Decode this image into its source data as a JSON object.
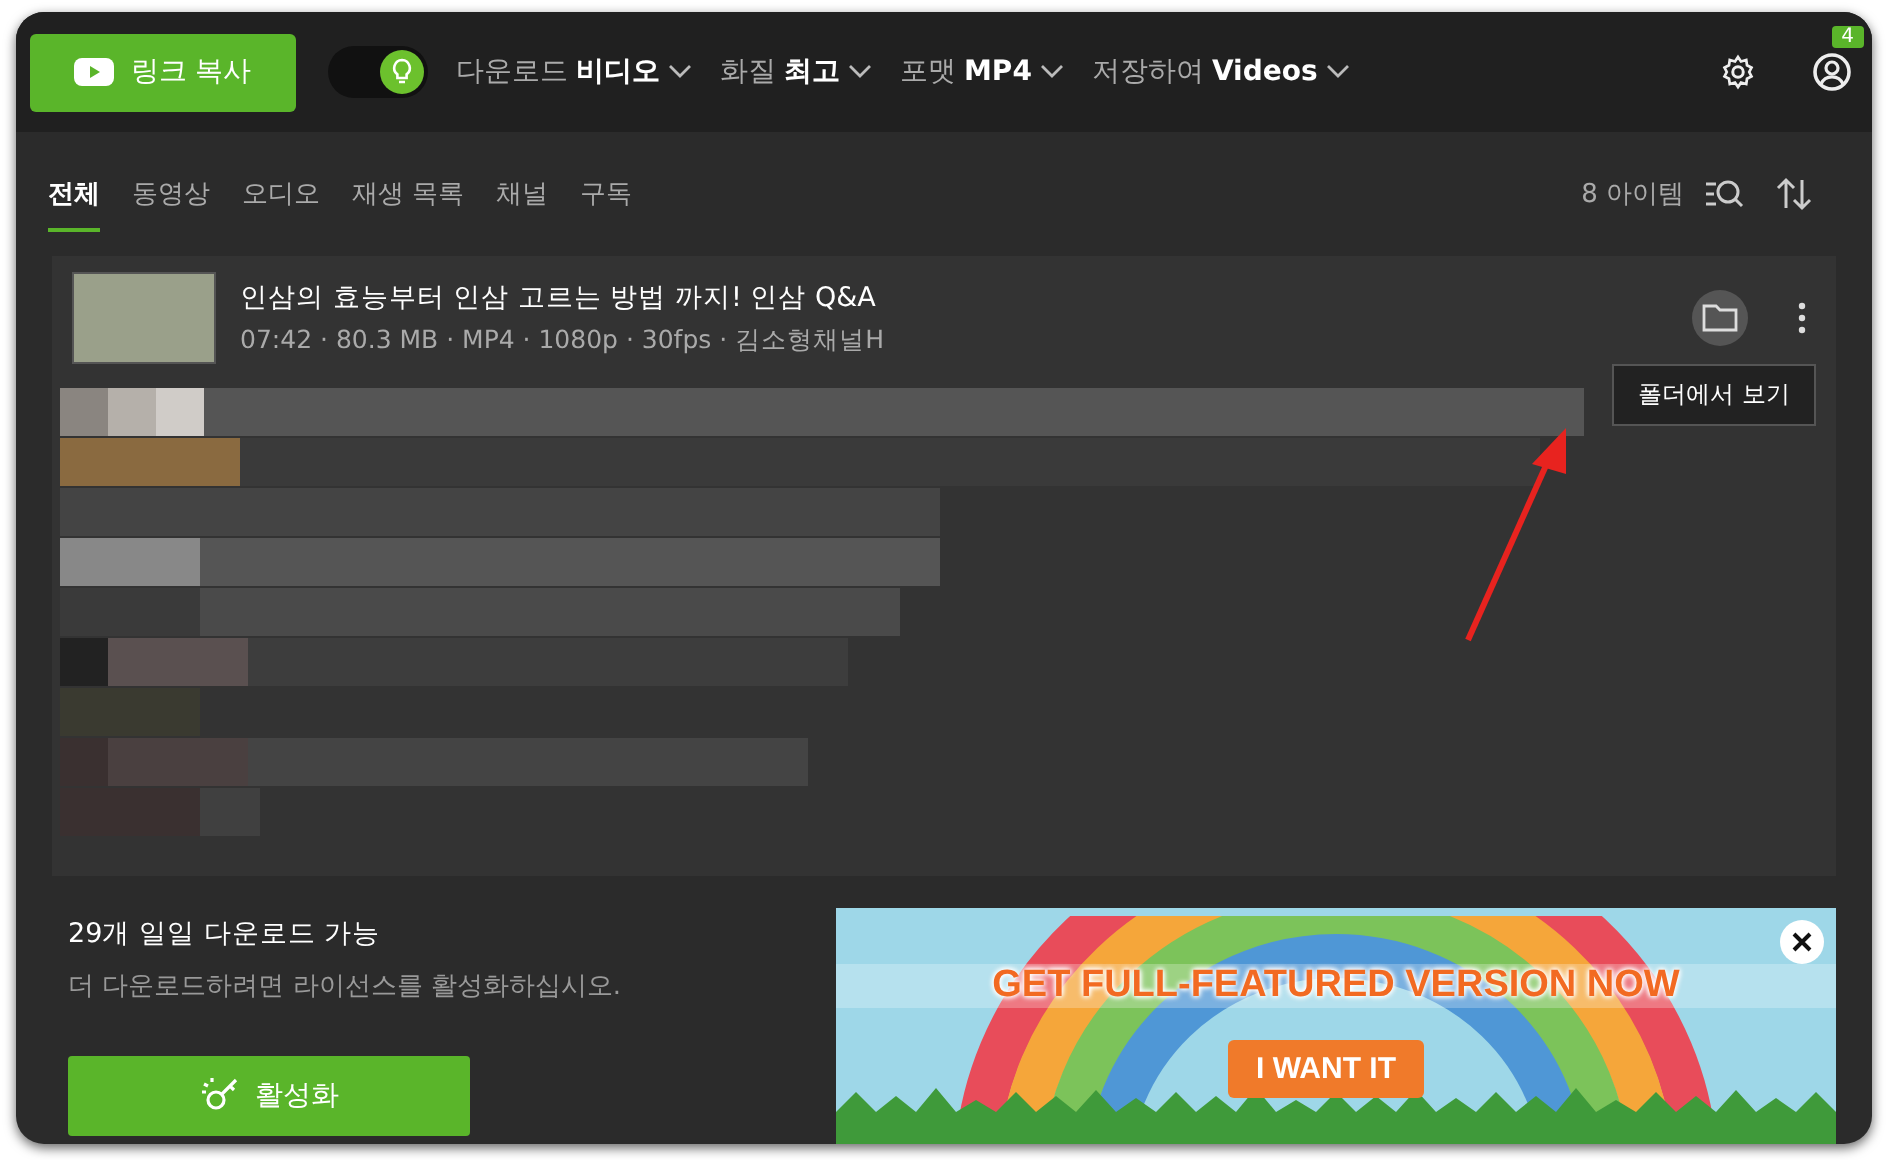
{
  "toolbar": {
    "copy_button": "링크 복사",
    "smart_mode": {
      "on": true
    },
    "dropdowns": [
      {
        "label": "다운로드",
        "value": "비디오"
      },
      {
        "label": "화질",
        "value": "최고"
      },
      {
        "label": "포맷",
        "value": "MP4"
      },
      {
        "label": "저장하여",
        "value": "Videos"
      }
    ],
    "badge": "4"
  },
  "tabs": [
    {
      "label": "전체",
      "selected": true
    },
    {
      "label": "동영상",
      "selected": false
    },
    {
      "label": "오디오",
      "selected": false
    },
    {
      "label": "재생 목록",
      "selected": false
    },
    {
      "label": "채널",
      "selected": false
    },
    {
      "label": "구독",
      "selected": false
    }
  ],
  "item_count": "8 아이템",
  "items": [
    {
      "title": "인삼의 효능부터 인삼 고르는 방법 까지! 인삼 Q&A",
      "meta": "07:42 · 80.3 MB · MP4 · 1080p · 30fps · 김소형채널H"
    }
  ],
  "tooltip": "폴더에서 보기",
  "license": {
    "title": "29개 일일 다운로드 가능",
    "text": "더 다운로드하려면 라이선스를 활성화하십시오.",
    "button": "활성화"
  },
  "ad": {
    "headline": "GET FULL-FEATURED VERSION NOW",
    "button": "I WANT IT"
  }
}
